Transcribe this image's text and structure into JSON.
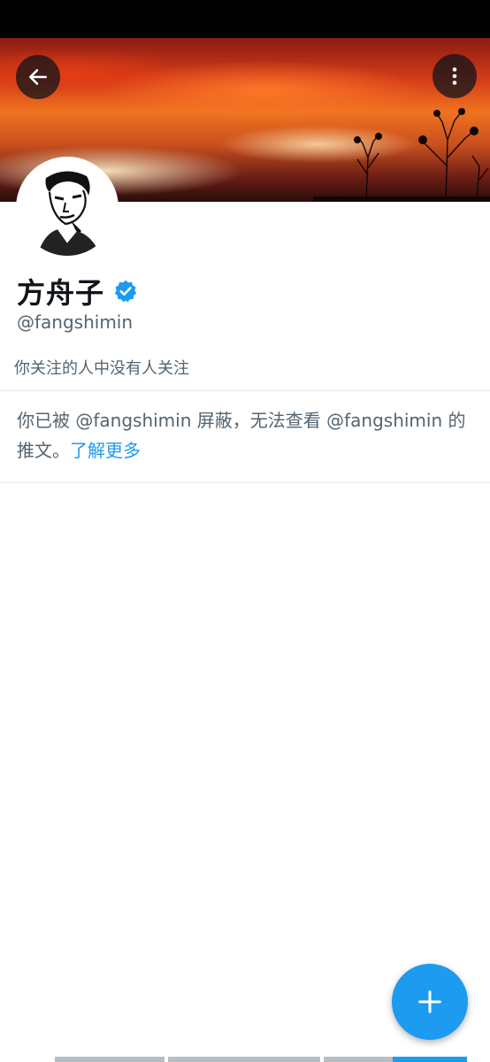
{
  "profile": {
    "display_name": "方舟子",
    "handle": "@fangshimin",
    "follow_note": "你关注的人中没有人关注",
    "blocked_message": "你已被 @fangshimin 屏蔽，无法查看 @fangshimin 的推文。",
    "learn_more": "了解更多"
  },
  "icons": {
    "back": "arrow-left-icon",
    "more": "more-vertical-icon",
    "verified": "verified-badge-icon",
    "compose": "plus-icon"
  },
  "colors": {
    "accent": "#1d9bf0",
    "secondary_text": "#536471",
    "primary_text": "#0f1419"
  }
}
